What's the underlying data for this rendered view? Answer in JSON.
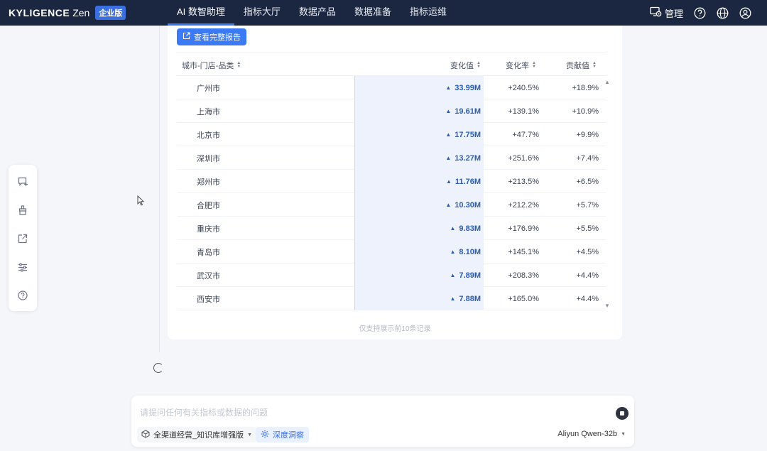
{
  "brand": {
    "name": "KYLIGENCE",
    "product": "Zen",
    "edition": "企业版"
  },
  "nav": {
    "items": [
      {
        "label": "AI 数智助理",
        "active": true
      },
      {
        "label": "指标大厅",
        "active": false
      },
      {
        "label": "数据产品",
        "active": false
      },
      {
        "label": "数据准备",
        "active": false
      },
      {
        "label": "指标运维",
        "active": false
      }
    ],
    "admin_label": "管理"
  },
  "report": {
    "button_label": "查看完整报告",
    "columns": {
      "dimension": "城市-门店-品类",
      "change_value": "变化值",
      "change_rate": "变化率",
      "contribution": "贡献值"
    },
    "rows": [
      {
        "name": "广州市",
        "value": "33.99M",
        "rate": "+240.5%",
        "contribution": "+18.9%"
      },
      {
        "name": "上海市",
        "value": "19.61M",
        "rate": "+139.1%",
        "contribution": "+10.9%"
      },
      {
        "name": "北京市",
        "value": "17.75M",
        "rate": "+47.7%",
        "contribution": "+9.9%"
      },
      {
        "name": "深圳市",
        "value": "13.27M",
        "rate": "+251.6%",
        "contribution": "+7.4%"
      },
      {
        "name": "郑州市",
        "value": "11.76M",
        "rate": "+213.5%",
        "contribution": "+6.5%"
      },
      {
        "name": "合肥市",
        "value": "10.30M",
        "rate": "+212.2%",
        "contribution": "+5.7%"
      },
      {
        "name": "重庆市",
        "value": "9.83M",
        "rate": "+176.9%",
        "contribution": "+5.5%"
      },
      {
        "name": "青岛市",
        "value": "8.10M",
        "rate": "+145.1%",
        "contribution": "+4.5%"
      },
      {
        "name": "武汉市",
        "value": "7.89M",
        "rate": "+208.3%",
        "contribution": "+4.4%"
      },
      {
        "name": "西安市",
        "value": "7.88M",
        "rate": "+165.0%",
        "contribution": "+4.4%"
      }
    ],
    "footnote": "仅支持展示前10条记录"
  },
  "chat": {
    "placeholder": "请提问任何有关指标或数据的问题",
    "knowledge_base": "全渠道经营_知识库增强版",
    "deep_insight_label": "深度洞察",
    "model": "Aliyun Qwen-32b"
  },
  "sidebar_tools": [
    "new-chat-icon",
    "broom-icon",
    "export-icon",
    "settings-sliders-icon",
    "help-icon"
  ],
  "colors": {
    "nav_bg": "#1b2640",
    "accent": "#3b7af3",
    "value_text": "#2b5db7"
  }
}
